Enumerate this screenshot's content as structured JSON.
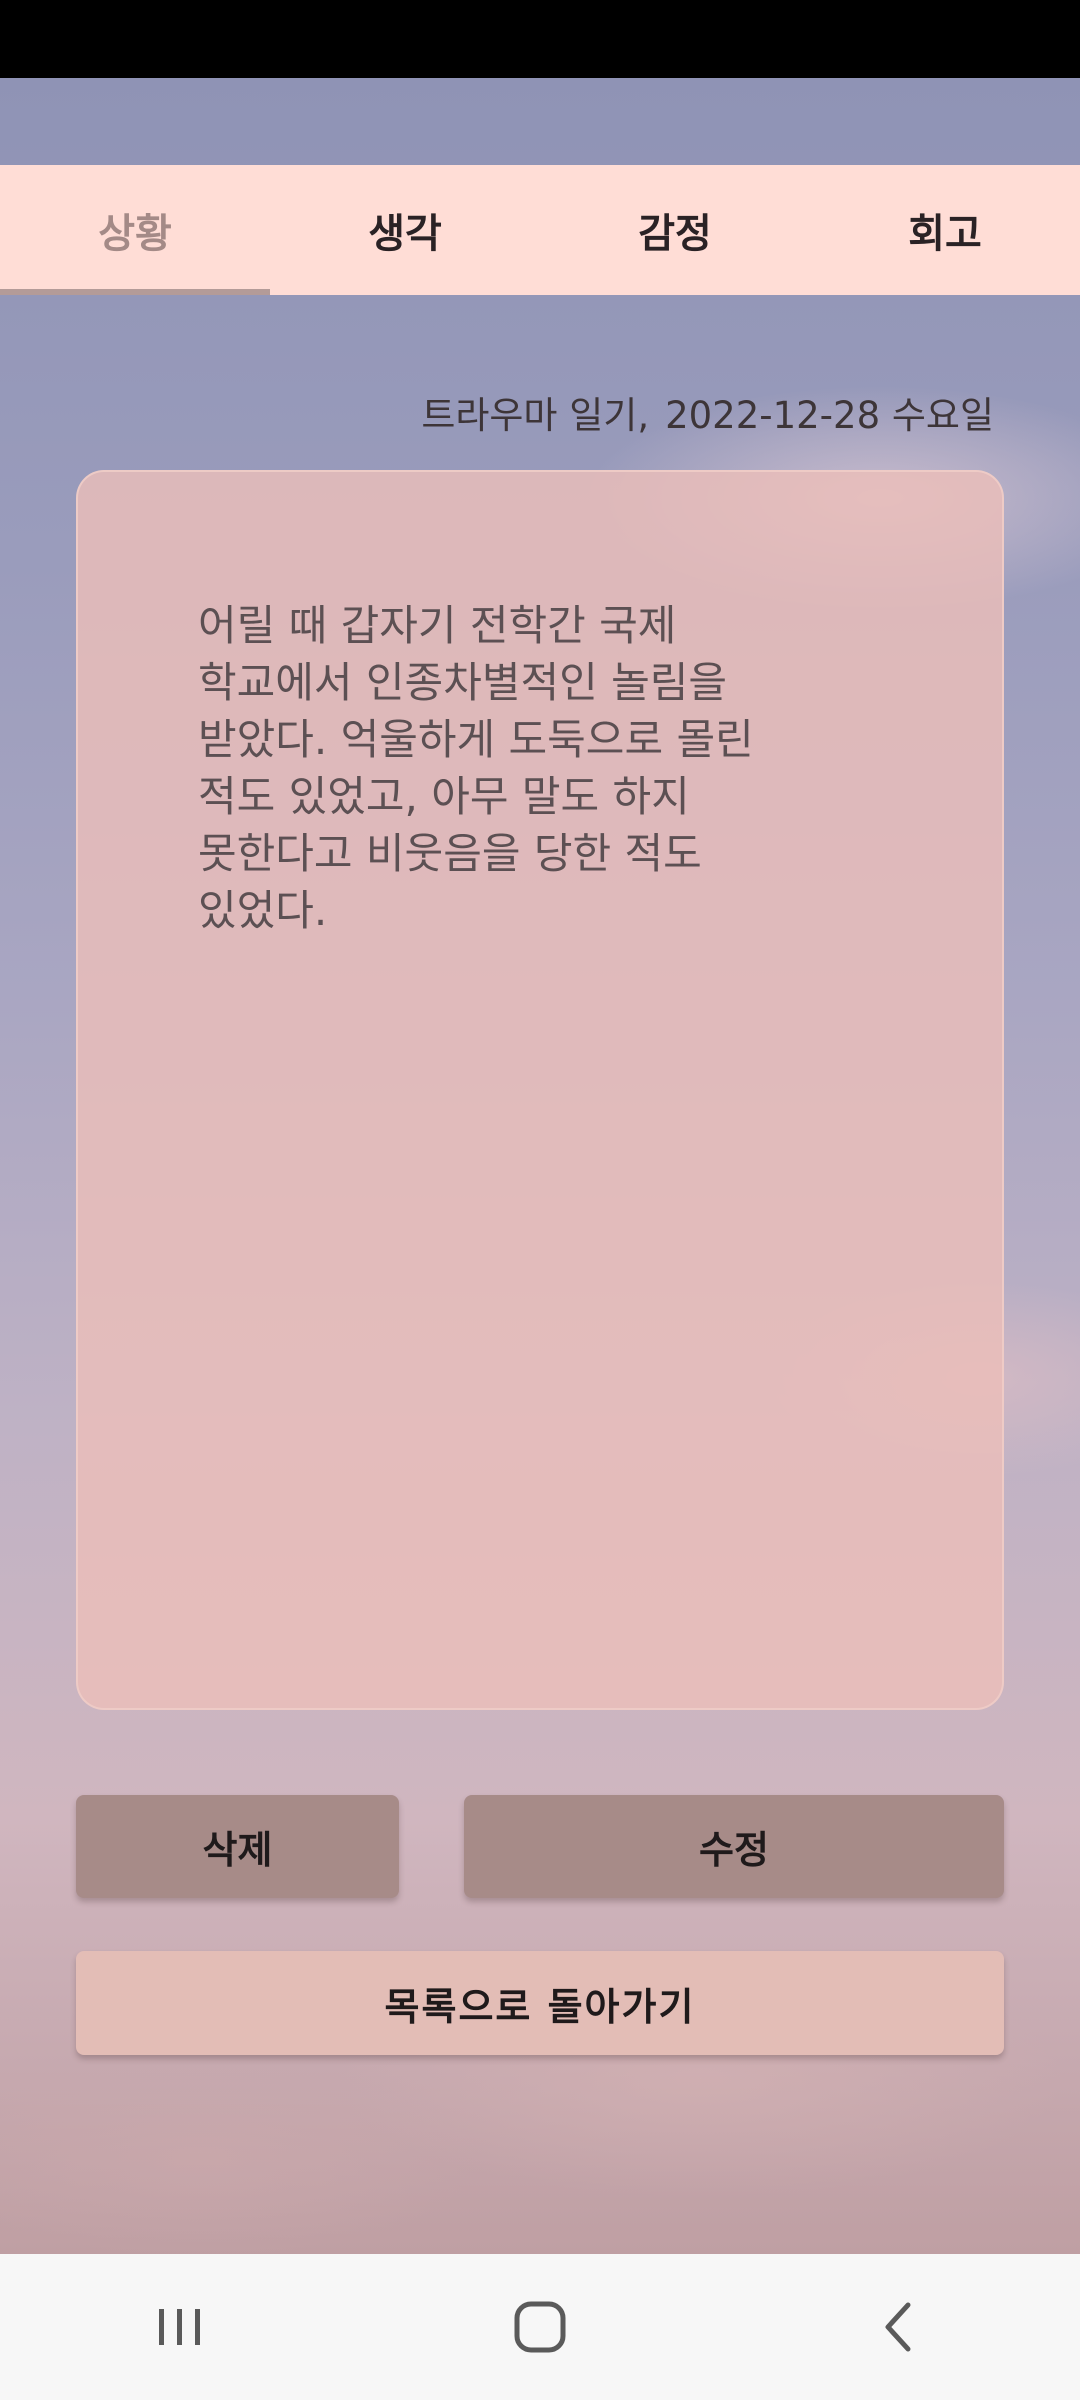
{
  "tabs": [
    {
      "label": "상황",
      "active": true
    },
    {
      "label": "생각",
      "active": false
    },
    {
      "label": "감정",
      "active": false
    },
    {
      "label": "회고",
      "active": false
    }
  ],
  "entry": {
    "diary_type": "트라우마 일기,",
    "date": "2022-12-28 수요일",
    "text_lines": [
      "어릴 때 갑자기 전학간 국제",
      "학교에서 인종차별적인 놀림을",
      "받았다. 억울하게 도둑으로 몰린",
      "적도 있었고, 아무 말도 하지",
      "못한다고 비웃음을 당한 적도",
      "있었다."
    ]
  },
  "buttons": {
    "delete_label": "삭제",
    "edit_label": "수정",
    "back_label": "목록으로 돌아가기"
  },
  "navigation": {
    "recents_icon": "recents-icon",
    "home_icon": "home-icon",
    "back_icon": "back-icon"
  },
  "colors": {
    "tab_bar_bg": "#ffddd6",
    "active_tab": "#a48a87",
    "card_bg": "#ebbeba",
    "action_button": "#a78b88",
    "back_button": "#e3bdb6"
  }
}
